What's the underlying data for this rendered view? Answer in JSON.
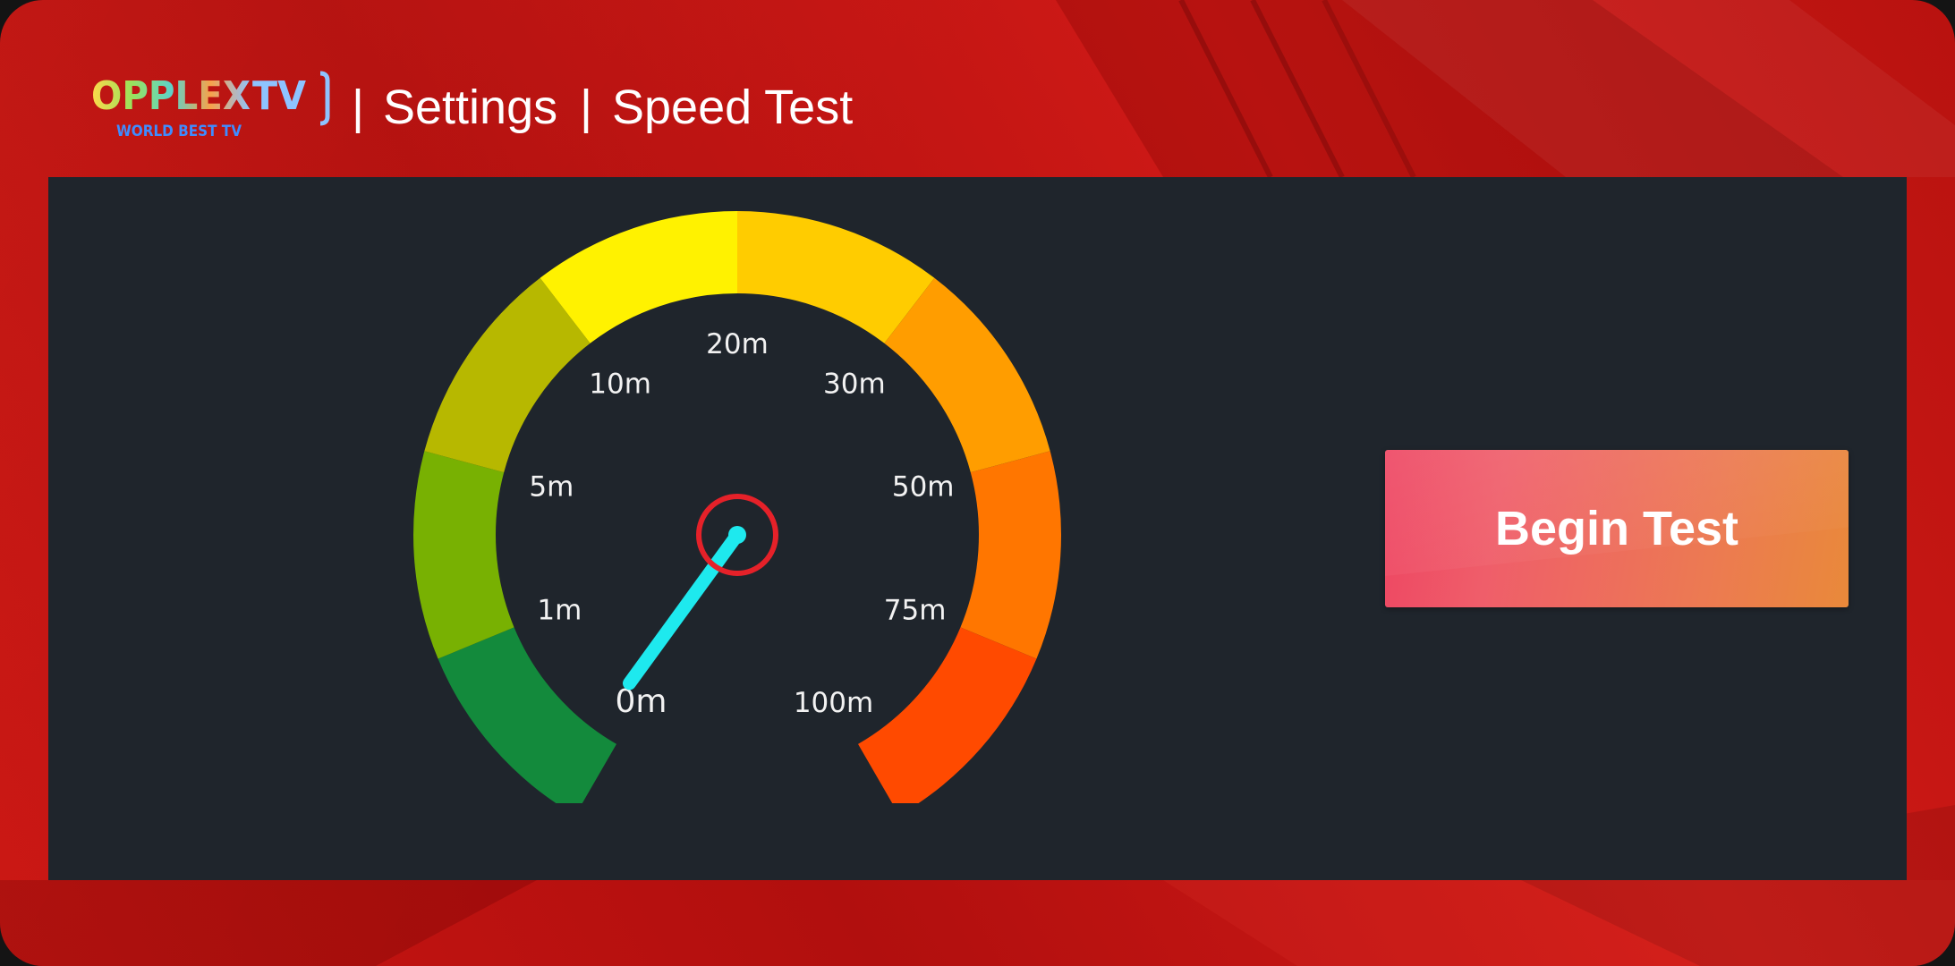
{
  "header": {
    "logo": {
      "brand": "OPPLEX",
      "brand_suffix": "TV",
      "tagline": "WORLD BEST TV"
    },
    "separator": "|",
    "breadcrumb": [
      "Settings",
      "Speed Test"
    ]
  },
  "speedometer": {
    "tick_labels": [
      "0m",
      "1m",
      "5m",
      "10m",
      "20m",
      "30m",
      "50m",
      "75m",
      "100m"
    ],
    "needle_value_label": "0m",
    "band_colors": [
      "#138a3c",
      "#78b102",
      "#b7b800",
      "#fff200",
      "#ffcc00",
      "#ff9d00",
      "#ff7600",
      "#ff4a00"
    ],
    "needle_color": "#1ee9ee",
    "hub_color": "#e52129"
  },
  "actions": {
    "begin_test_label": "Begin Test"
  },
  "colors": {
    "background_red": "#c91512",
    "panel": "#1f252c",
    "button_start": "#ee4562",
    "button_end": "#e9893a"
  }
}
